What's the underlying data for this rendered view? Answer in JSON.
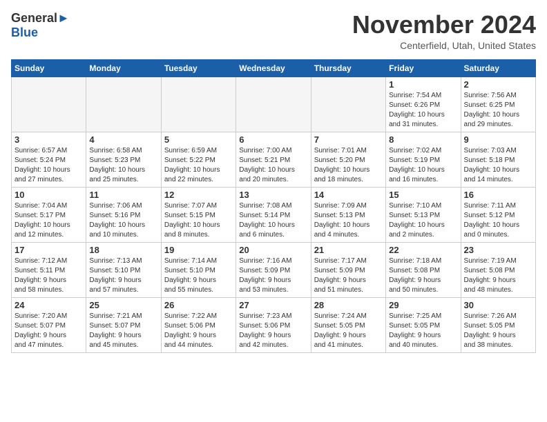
{
  "header": {
    "logo_line1": "General",
    "logo_line2": "Blue",
    "month": "November 2024",
    "location": "Centerfield, Utah, United States"
  },
  "days_of_week": [
    "Sunday",
    "Monday",
    "Tuesday",
    "Wednesday",
    "Thursday",
    "Friday",
    "Saturday"
  ],
  "weeks": [
    [
      {
        "day": "",
        "info": "",
        "empty": true
      },
      {
        "day": "",
        "info": "",
        "empty": true
      },
      {
        "day": "",
        "info": "",
        "empty": true
      },
      {
        "day": "",
        "info": "",
        "empty": true
      },
      {
        "day": "",
        "info": "",
        "empty": true
      },
      {
        "day": "1",
        "info": "Sunrise: 7:54 AM\nSunset: 6:26 PM\nDaylight: 10 hours\nand 31 minutes.",
        "empty": false
      },
      {
        "day": "2",
        "info": "Sunrise: 7:56 AM\nSunset: 6:25 PM\nDaylight: 10 hours\nand 29 minutes.",
        "empty": false
      }
    ],
    [
      {
        "day": "3",
        "info": "Sunrise: 6:57 AM\nSunset: 5:24 PM\nDaylight: 10 hours\nand 27 minutes.",
        "empty": false
      },
      {
        "day": "4",
        "info": "Sunrise: 6:58 AM\nSunset: 5:23 PM\nDaylight: 10 hours\nand 25 minutes.",
        "empty": false
      },
      {
        "day": "5",
        "info": "Sunrise: 6:59 AM\nSunset: 5:22 PM\nDaylight: 10 hours\nand 22 minutes.",
        "empty": false
      },
      {
        "day": "6",
        "info": "Sunrise: 7:00 AM\nSunset: 5:21 PM\nDaylight: 10 hours\nand 20 minutes.",
        "empty": false
      },
      {
        "day": "7",
        "info": "Sunrise: 7:01 AM\nSunset: 5:20 PM\nDaylight: 10 hours\nand 18 minutes.",
        "empty": false
      },
      {
        "day": "8",
        "info": "Sunrise: 7:02 AM\nSunset: 5:19 PM\nDaylight: 10 hours\nand 16 minutes.",
        "empty": false
      },
      {
        "day": "9",
        "info": "Sunrise: 7:03 AM\nSunset: 5:18 PM\nDaylight: 10 hours\nand 14 minutes.",
        "empty": false
      }
    ],
    [
      {
        "day": "10",
        "info": "Sunrise: 7:04 AM\nSunset: 5:17 PM\nDaylight: 10 hours\nand 12 minutes.",
        "empty": false
      },
      {
        "day": "11",
        "info": "Sunrise: 7:06 AM\nSunset: 5:16 PM\nDaylight: 10 hours\nand 10 minutes.",
        "empty": false
      },
      {
        "day": "12",
        "info": "Sunrise: 7:07 AM\nSunset: 5:15 PM\nDaylight: 10 hours\nand 8 minutes.",
        "empty": false
      },
      {
        "day": "13",
        "info": "Sunrise: 7:08 AM\nSunset: 5:14 PM\nDaylight: 10 hours\nand 6 minutes.",
        "empty": false
      },
      {
        "day": "14",
        "info": "Sunrise: 7:09 AM\nSunset: 5:13 PM\nDaylight: 10 hours\nand 4 minutes.",
        "empty": false
      },
      {
        "day": "15",
        "info": "Sunrise: 7:10 AM\nSunset: 5:13 PM\nDaylight: 10 hours\nand 2 minutes.",
        "empty": false
      },
      {
        "day": "16",
        "info": "Sunrise: 7:11 AM\nSunset: 5:12 PM\nDaylight: 10 hours\nand 0 minutes.",
        "empty": false
      }
    ],
    [
      {
        "day": "17",
        "info": "Sunrise: 7:12 AM\nSunset: 5:11 PM\nDaylight: 9 hours\nand 58 minutes.",
        "empty": false
      },
      {
        "day": "18",
        "info": "Sunrise: 7:13 AM\nSunset: 5:10 PM\nDaylight: 9 hours\nand 57 minutes.",
        "empty": false
      },
      {
        "day": "19",
        "info": "Sunrise: 7:14 AM\nSunset: 5:10 PM\nDaylight: 9 hours\nand 55 minutes.",
        "empty": false
      },
      {
        "day": "20",
        "info": "Sunrise: 7:16 AM\nSunset: 5:09 PM\nDaylight: 9 hours\nand 53 minutes.",
        "empty": false
      },
      {
        "day": "21",
        "info": "Sunrise: 7:17 AM\nSunset: 5:09 PM\nDaylight: 9 hours\nand 51 minutes.",
        "empty": false
      },
      {
        "day": "22",
        "info": "Sunrise: 7:18 AM\nSunset: 5:08 PM\nDaylight: 9 hours\nand 50 minutes.",
        "empty": false
      },
      {
        "day": "23",
        "info": "Sunrise: 7:19 AM\nSunset: 5:08 PM\nDaylight: 9 hours\nand 48 minutes.",
        "empty": false
      }
    ],
    [
      {
        "day": "24",
        "info": "Sunrise: 7:20 AM\nSunset: 5:07 PM\nDaylight: 9 hours\nand 47 minutes.",
        "empty": false
      },
      {
        "day": "25",
        "info": "Sunrise: 7:21 AM\nSunset: 5:07 PM\nDaylight: 9 hours\nand 45 minutes.",
        "empty": false
      },
      {
        "day": "26",
        "info": "Sunrise: 7:22 AM\nSunset: 5:06 PM\nDaylight: 9 hours\nand 44 minutes.",
        "empty": false
      },
      {
        "day": "27",
        "info": "Sunrise: 7:23 AM\nSunset: 5:06 PM\nDaylight: 9 hours\nand 42 minutes.",
        "empty": false
      },
      {
        "day": "28",
        "info": "Sunrise: 7:24 AM\nSunset: 5:05 PM\nDaylight: 9 hours\nand 41 minutes.",
        "empty": false
      },
      {
        "day": "29",
        "info": "Sunrise: 7:25 AM\nSunset: 5:05 PM\nDaylight: 9 hours\nand 40 minutes.",
        "empty": false
      },
      {
        "day": "30",
        "info": "Sunrise: 7:26 AM\nSunset: 5:05 PM\nDaylight: 9 hours\nand 38 minutes.",
        "empty": false
      }
    ]
  ]
}
